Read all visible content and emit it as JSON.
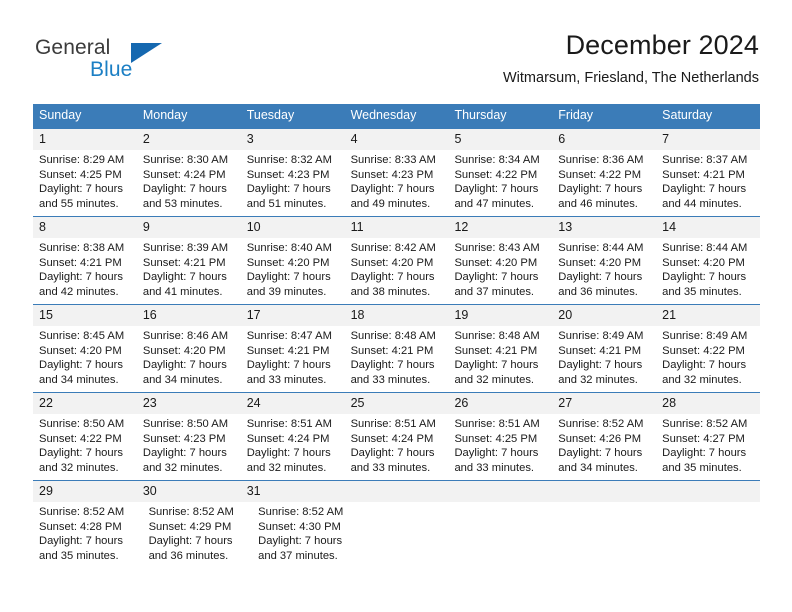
{
  "brand": {
    "name_part1": "General",
    "name_part2": "Blue",
    "triangle_color": "#1568b0",
    "blue_text_color": "#1c7fc4",
    "gray_text_color": "#3b3b3b"
  },
  "header": {
    "title": "December 2024",
    "subtitle": "Witmarsum, Friesland, The Netherlands"
  },
  "calendar": {
    "header_bg": "#3b7cb8",
    "daynum_bg": "#f2f2f2",
    "weekdays": [
      "Sunday",
      "Monday",
      "Tuesday",
      "Wednesday",
      "Thursday",
      "Friday",
      "Saturday"
    ],
    "weeks": [
      {
        "days": [
          {
            "num": "1",
            "sunrise": "Sunrise: 8:29 AM",
            "sunset": "Sunset: 4:25 PM",
            "daylight1": "Daylight: 7 hours",
            "daylight2": "and 55 minutes."
          },
          {
            "num": "2",
            "sunrise": "Sunrise: 8:30 AM",
            "sunset": "Sunset: 4:24 PM",
            "daylight1": "Daylight: 7 hours",
            "daylight2": "and 53 minutes."
          },
          {
            "num": "3",
            "sunrise": "Sunrise: 8:32 AM",
            "sunset": "Sunset: 4:23 PM",
            "daylight1": "Daylight: 7 hours",
            "daylight2": "and 51 minutes."
          },
          {
            "num": "4",
            "sunrise": "Sunrise: 8:33 AM",
            "sunset": "Sunset: 4:23 PM",
            "daylight1": "Daylight: 7 hours",
            "daylight2": "and 49 minutes."
          },
          {
            "num": "5",
            "sunrise": "Sunrise: 8:34 AM",
            "sunset": "Sunset: 4:22 PM",
            "daylight1": "Daylight: 7 hours",
            "daylight2": "and 47 minutes."
          },
          {
            "num": "6",
            "sunrise": "Sunrise: 8:36 AM",
            "sunset": "Sunset: 4:22 PM",
            "daylight1": "Daylight: 7 hours",
            "daylight2": "and 46 minutes."
          },
          {
            "num": "7",
            "sunrise": "Sunrise: 8:37 AM",
            "sunset": "Sunset: 4:21 PM",
            "daylight1": "Daylight: 7 hours",
            "daylight2": "and 44 minutes."
          }
        ]
      },
      {
        "days": [
          {
            "num": "8",
            "sunrise": "Sunrise: 8:38 AM",
            "sunset": "Sunset: 4:21 PM",
            "daylight1": "Daylight: 7 hours",
            "daylight2": "and 42 minutes."
          },
          {
            "num": "9",
            "sunrise": "Sunrise: 8:39 AM",
            "sunset": "Sunset: 4:21 PM",
            "daylight1": "Daylight: 7 hours",
            "daylight2": "and 41 minutes."
          },
          {
            "num": "10",
            "sunrise": "Sunrise: 8:40 AM",
            "sunset": "Sunset: 4:20 PM",
            "daylight1": "Daylight: 7 hours",
            "daylight2": "and 39 minutes."
          },
          {
            "num": "11",
            "sunrise": "Sunrise: 8:42 AM",
            "sunset": "Sunset: 4:20 PM",
            "daylight1": "Daylight: 7 hours",
            "daylight2": "and 38 minutes."
          },
          {
            "num": "12",
            "sunrise": "Sunrise: 8:43 AM",
            "sunset": "Sunset: 4:20 PM",
            "daylight1": "Daylight: 7 hours",
            "daylight2": "and 37 minutes."
          },
          {
            "num": "13",
            "sunrise": "Sunrise: 8:44 AM",
            "sunset": "Sunset: 4:20 PM",
            "daylight1": "Daylight: 7 hours",
            "daylight2": "and 36 minutes."
          },
          {
            "num": "14",
            "sunrise": "Sunrise: 8:44 AM",
            "sunset": "Sunset: 4:20 PM",
            "daylight1": "Daylight: 7 hours",
            "daylight2": "and 35 minutes."
          }
        ]
      },
      {
        "days": [
          {
            "num": "15",
            "sunrise": "Sunrise: 8:45 AM",
            "sunset": "Sunset: 4:20 PM",
            "daylight1": "Daylight: 7 hours",
            "daylight2": "and 34 minutes."
          },
          {
            "num": "16",
            "sunrise": "Sunrise: 8:46 AM",
            "sunset": "Sunset: 4:20 PM",
            "daylight1": "Daylight: 7 hours",
            "daylight2": "and 34 minutes."
          },
          {
            "num": "17",
            "sunrise": "Sunrise: 8:47 AM",
            "sunset": "Sunset: 4:21 PM",
            "daylight1": "Daylight: 7 hours",
            "daylight2": "and 33 minutes."
          },
          {
            "num": "18",
            "sunrise": "Sunrise: 8:48 AM",
            "sunset": "Sunset: 4:21 PM",
            "daylight1": "Daylight: 7 hours",
            "daylight2": "and 33 minutes."
          },
          {
            "num": "19",
            "sunrise": "Sunrise: 8:48 AM",
            "sunset": "Sunset: 4:21 PM",
            "daylight1": "Daylight: 7 hours",
            "daylight2": "and 32 minutes."
          },
          {
            "num": "20",
            "sunrise": "Sunrise: 8:49 AM",
            "sunset": "Sunset: 4:21 PM",
            "daylight1": "Daylight: 7 hours",
            "daylight2": "and 32 minutes."
          },
          {
            "num": "21",
            "sunrise": "Sunrise: 8:49 AM",
            "sunset": "Sunset: 4:22 PM",
            "daylight1": "Daylight: 7 hours",
            "daylight2": "and 32 minutes."
          }
        ]
      },
      {
        "days": [
          {
            "num": "22",
            "sunrise": "Sunrise: 8:50 AM",
            "sunset": "Sunset: 4:22 PM",
            "daylight1": "Daylight: 7 hours",
            "daylight2": "and 32 minutes."
          },
          {
            "num": "23",
            "sunrise": "Sunrise: 8:50 AM",
            "sunset": "Sunset: 4:23 PM",
            "daylight1": "Daylight: 7 hours",
            "daylight2": "and 32 minutes."
          },
          {
            "num": "24",
            "sunrise": "Sunrise: 8:51 AM",
            "sunset": "Sunset: 4:24 PM",
            "daylight1": "Daylight: 7 hours",
            "daylight2": "and 32 minutes."
          },
          {
            "num": "25",
            "sunrise": "Sunrise: 8:51 AM",
            "sunset": "Sunset: 4:24 PM",
            "daylight1": "Daylight: 7 hours",
            "daylight2": "and 33 minutes."
          },
          {
            "num": "26",
            "sunrise": "Sunrise: 8:51 AM",
            "sunset": "Sunset: 4:25 PM",
            "daylight1": "Daylight: 7 hours",
            "daylight2": "and 33 minutes."
          },
          {
            "num": "27",
            "sunrise": "Sunrise: 8:52 AM",
            "sunset": "Sunset: 4:26 PM",
            "daylight1": "Daylight: 7 hours",
            "daylight2": "and 34 minutes."
          },
          {
            "num": "28",
            "sunrise": "Sunrise: 8:52 AM",
            "sunset": "Sunset: 4:27 PM",
            "daylight1": "Daylight: 7 hours",
            "daylight2": "and 35 minutes."
          }
        ]
      },
      {
        "days": [
          {
            "num": "29",
            "sunrise": "Sunrise: 8:52 AM",
            "sunset": "Sunset: 4:28 PM",
            "daylight1": "Daylight: 7 hours",
            "daylight2": "and 35 minutes."
          },
          {
            "num": "30",
            "sunrise": "Sunrise: 8:52 AM",
            "sunset": "Sunset: 4:29 PM",
            "daylight1": "Daylight: 7 hours",
            "daylight2": "and 36 minutes."
          },
          {
            "num": "31",
            "sunrise": "Sunrise: 8:52 AM",
            "sunset": "Sunset: 4:30 PM",
            "daylight1": "Daylight: 7 hours",
            "daylight2": "and 37 minutes."
          },
          {
            "num": "",
            "sunrise": "",
            "sunset": "",
            "daylight1": "",
            "daylight2": ""
          },
          {
            "num": "",
            "sunrise": "",
            "sunset": "",
            "daylight1": "",
            "daylight2": ""
          },
          {
            "num": "",
            "sunrise": "",
            "sunset": "",
            "daylight1": "",
            "daylight2": ""
          },
          {
            "num": "",
            "sunrise": "",
            "sunset": "",
            "daylight1": "",
            "daylight2": ""
          }
        ]
      }
    ]
  }
}
